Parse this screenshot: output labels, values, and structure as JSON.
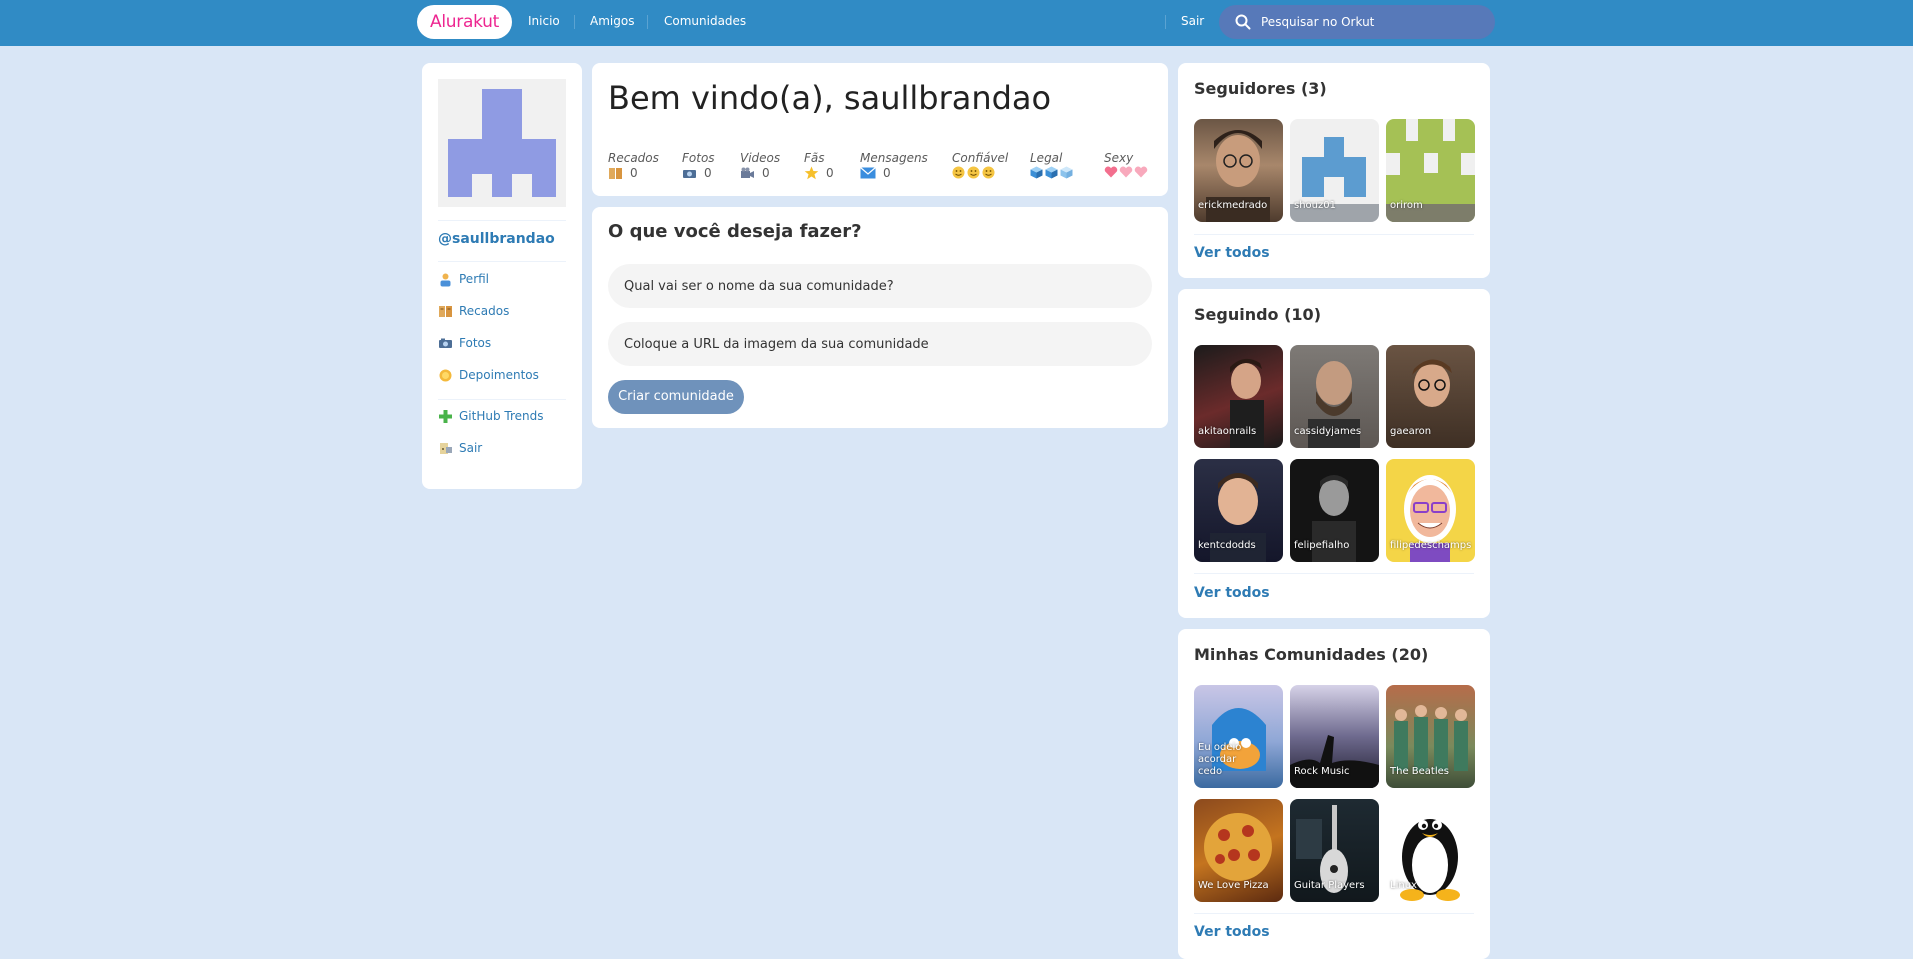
{
  "header": {
    "logo": "Alurakut",
    "nav": [
      "Inicio",
      "Amigos",
      "Comunidades"
    ],
    "logout": "Sair",
    "search_placeholder": "Pesquisar no Orkut"
  },
  "sidebar": {
    "username": "@saullbrandao",
    "items": [
      {
        "label": "Perfil",
        "icon": "user-icon"
      },
      {
        "label": "Recados",
        "icon": "book-icon"
      },
      {
        "label": "Fotos",
        "icon": "camera-icon"
      },
      {
        "label": "Depoimentos",
        "icon": "sun-icon"
      }
    ],
    "items2": [
      {
        "label": "GitHub Trends",
        "icon": "plus-icon"
      },
      {
        "label": "Sair",
        "icon": "logout-icon"
      }
    ]
  },
  "welcome": {
    "title": "Bem vindo(a), saullbrandao",
    "stats": [
      {
        "label": "Recados",
        "value": "0",
        "icon": "book-icon"
      },
      {
        "label": "Fotos",
        "value": "0",
        "icon": "camera-icon"
      },
      {
        "label": "Videos",
        "value": "0",
        "icon": "video-camera-icon"
      },
      {
        "label": "Fãs",
        "value": "0",
        "icon": "star-icon"
      },
      {
        "label": "Mensagens",
        "value": "0",
        "icon": "envelope-icon"
      },
      {
        "label": "Confiável",
        "icon": "smiley-icon"
      },
      {
        "label": "Legal",
        "icon": "ice-cube-icon"
      },
      {
        "label": "Sexy",
        "icon": "heart-icon"
      }
    ]
  },
  "action": {
    "title": "O que você deseja fazer?",
    "name_placeholder": "Qual vai ser o nome da sua comunidade?",
    "image_placeholder": "Coloque a URL da imagem da sua comunidade",
    "submit": "Criar comunidade"
  },
  "followers": {
    "title": "Seguidores (3)",
    "items": [
      "erickmedrado",
      "shouz01",
      "orirom"
    ],
    "see_all": "Ver todos"
  },
  "following": {
    "title": "Seguindo (10)",
    "items": [
      "akitaonrails",
      "cassidyjames",
      "gaearon",
      "kentcdodds",
      "felipefialho",
      "filipedeschamps"
    ],
    "see_all": "Ver todos"
  },
  "communities": {
    "title": "Minhas Comunidades (20)",
    "items": [
      "Eu odeio acordar cedo",
      "Rock Music",
      "The Beatles",
      "We Love Pizza",
      "Guitar Players",
      "Linux"
    ],
    "see_all": "Ver todos"
  },
  "colors": {
    "topbar": "#308BC5",
    "background": "#D9E6F6",
    "link": "#2E7BB4",
    "logo_text": "#ED2590",
    "button": "#6F92BB"
  }
}
